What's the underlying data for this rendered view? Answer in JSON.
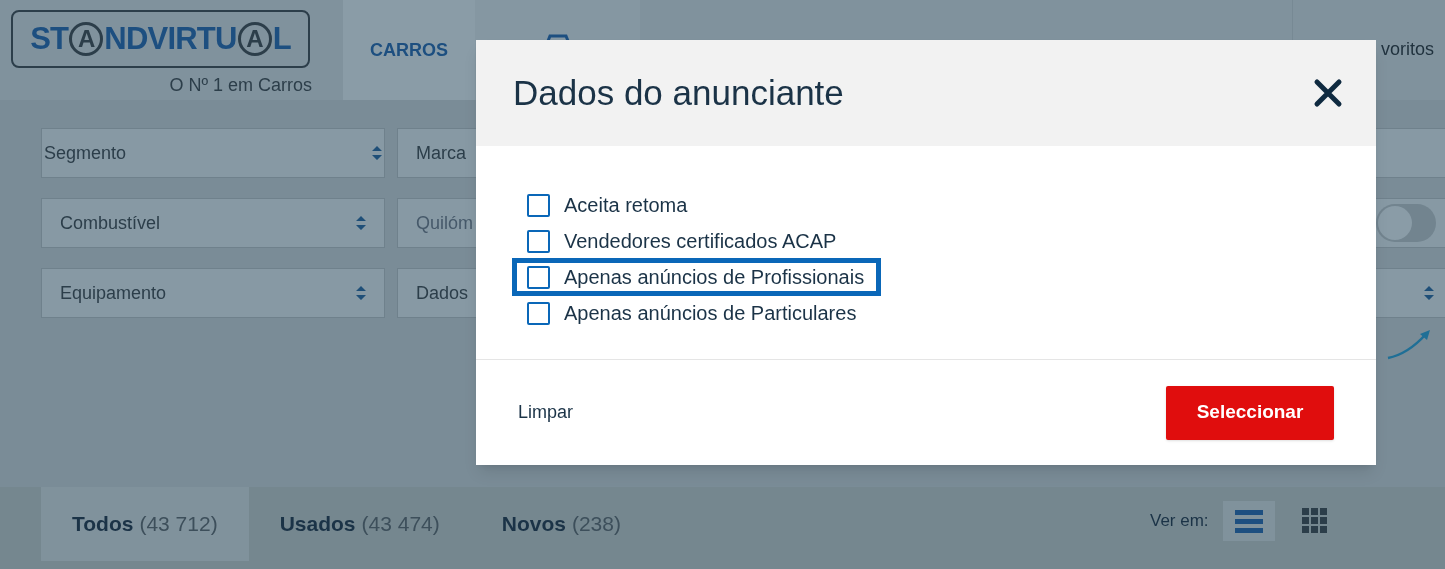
{
  "header": {
    "logo": [
      {
        "kind": "text",
        "text": "ST"
      },
      {
        "kind": "circled",
        "text": "A"
      },
      {
        "kind": "text",
        "text": "NDVIRTU"
      },
      {
        "kind": "circled",
        "text": "A"
      },
      {
        "kind": "text",
        "text": "L"
      }
    ],
    "tagline": "O Nº 1 em Carros",
    "nav": [
      {
        "label": "CARROS",
        "selected": true
      }
    ],
    "favorites": "voritos"
  },
  "filters": [
    [
      {
        "kind": "select",
        "label": "Segmento"
      },
      {
        "kind": "field",
        "label": "Marca"
      },
      {
        "kind": "blank"
      }
    ],
    [
      {
        "kind": "select",
        "label": "Combustível"
      },
      {
        "kind": "input",
        "placeholder": "Quilóm"
      },
      {
        "kind": "toggle",
        "on": false
      }
    ],
    [
      {
        "kind": "select",
        "label": "Equipamento"
      },
      {
        "kind": "field",
        "label": "Dados"
      },
      {
        "kind": "select"
      }
    ]
  ],
  "tabs": [
    {
      "label": "Todos",
      "count": "(43 712)",
      "selected": true
    },
    {
      "label": "Usados",
      "count": "(43 474)",
      "selected": false
    },
    {
      "label": "Novos",
      "count": "(238)",
      "selected": false
    }
  ],
  "view": {
    "label": "Ver em:",
    "options": [
      {
        "kind": "list",
        "selected": true
      },
      {
        "kind": "grid",
        "selected": false
      }
    ]
  },
  "modal": {
    "title": "Dados do anunciante",
    "options": [
      {
        "label": "Aceita retoma",
        "checked": false,
        "focused": false
      },
      {
        "label": "Vendedores certificados ACAP",
        "checked": false,
        "focused": false
      },
      {
        "label": "Apenas anúncios de Profissionais",
        "checked": false,
        "focused": true
      },
      {
        "label": "Apenas anúncios de Particulares",
        "checked": false,
        "focused": false
      }
    ],
    "clear": "Limpar",
    "submit": "Seleccionar"
  }
}
